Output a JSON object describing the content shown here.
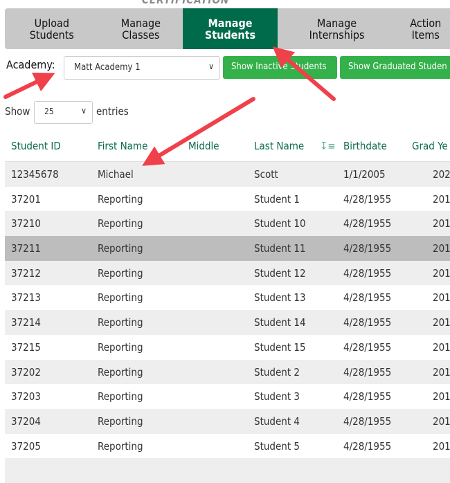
{
  "header": {
    "certification": "CERTIFICATION"
  },
  "tabs": [
    {
      "label": "Upload\nStudents",
      "active": false
    },
    {
      "label": "Manage\nClasses",
      "active": false
    },
    {
      "label": "Manage\nStudents",
      "active": true
    },
    {
      "label": "Manage\nInternships",
      "active": false
    },
    {
      "label": "Action\nItems",
      "active": false
    }
  ],
  "filters": {
    "academy_label": "Academy:",
    "academy_value": "Matt Academy 1",
    "show_inactive": "Show Inactive Students",
    "show_graduated": "Show Graduated Studen"
  },
  "length": {
    "show": "Show",
    "value": "25",
    "entries": "entries"
  },
  "table": {
    "columns": [
      "Student ID",
      "First Name",
      "Middle",
      "Last Name",
      "Birthdate",
      "Grad Ye"
    ],
    "rows": [
      [
        "12345678",
        "Michael",
        "",
        "Scott",
        "1/1/2005",
        "202"
      ],
      [
        "37201",
        "Reporting",
        "",
        "Student 1",
        "4/28/1955",
        "201"
      ],
      [
        "37210",
        "Reporting",
        "",
        "Student 10",
        "4/28/1955",
        "201"
      ],
      [
        "37211",
        "Reporting",
        "",
        "Student 11",
        "4/28/1955",
        "201"
      ],
      [
        "37212",
        "Reporting",
        "",
        "Student 12",
        "4/28/1955",
        "201"
      ],
      [
        "37213",
        "Reporting",
        "",
        "Student 13",
        "4/28/1955",
        "201"
      ],
      [
        "37214",
        "Reporting",
        "",
        "Student 14",
        "4/28/1955",
        "201"
      ],
      [
        "37215",
        "Reporting",
        "",
        "Student 15",
        "4/28/1955",
        "201"
      ],
      [
        "37202",
        "Reporting",
        "",
        "Student 2",
        "4/28/1955",
        "201"
      ],
      [
        "37203",
        "Reporting",
        "",
        "Student 3",
        "4/28/1955",
        "201"
      ],
      [
        "37204",
        "Reporting",
        "",
        "Student 4",
        "4/28/1955",
        "201"
      ],
      [
        "37205",
        "Reporting",
        "",
        "Student 5",
        "4/28/1955",
        "201"
      ],
      [
        "",
        "",
        "",
        "",
        "",
        ""
      ]
    ],
    "hovered_row": 3,
    "sorted_column": "Last Name"
  },
  "colors": {
    "accent": "#006b4a",
    "button": "#34b14a",
    "arrow": "#f0404a"
  }
}
